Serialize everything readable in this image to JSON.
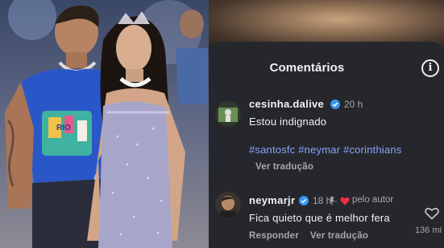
{
  "photo": {
    "shirt_text": "RIO"
  },
  "panel": {
    "title": "Comentários",
    "info_icon": "info-icon",
    "comments": [
      {
        "username": "cesinha.dalive",
        "verified": true,
        "time": "20 h",
        "text": "Estou indignado",
        "hashtags": "#santosfc #neymar #corinthians",
        "actions": [
          "Ver tradução"
        ]
      },
      {
        "username": "neymarjr",
        "verified": true,
        "time": "18 h",
        "pinned": true,
        "author_label": "pelo autor",
        "text": "Fica quieto que é melhor fera",
        "actions": [
          "Responder",
          "Ver tradução"
        ],
        "likes": "136 mi"
      }
    ]
  },
  "colors": {
    "sheet_bg": "#25272c",
    "text": "#f2f2f2",
    "muted": "#a8a8a8",
    "hashtag": "#8aa2ff",
    "verified": "#3897f0",
    "heart": "#ed2f4a"
  }
}
